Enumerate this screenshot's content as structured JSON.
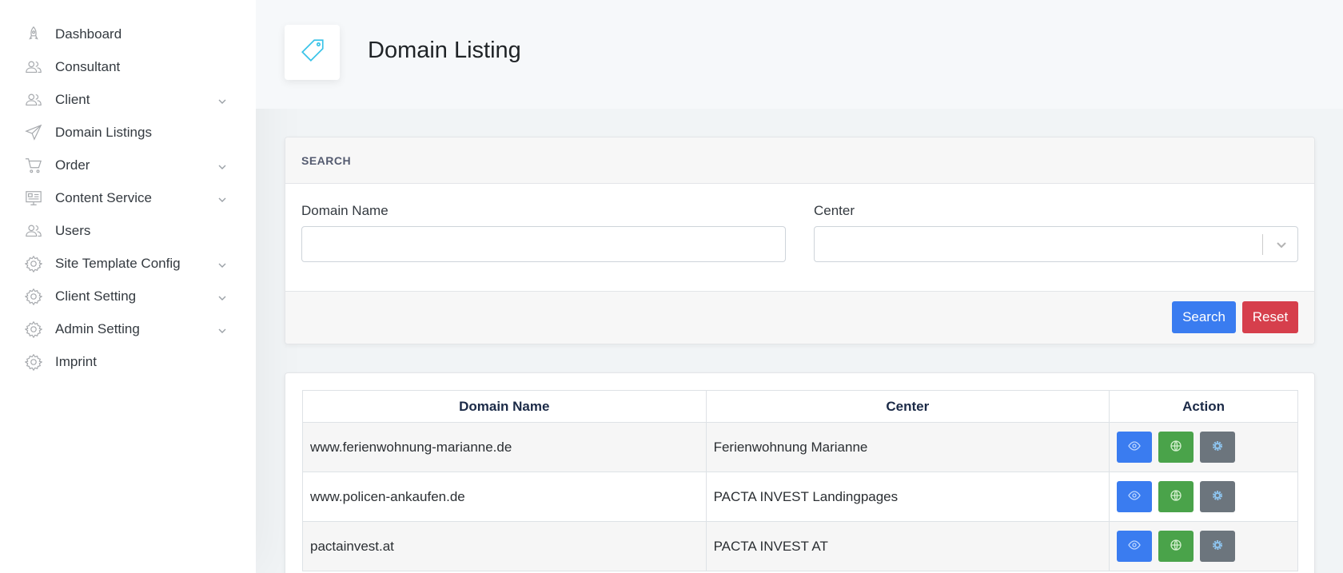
{
  "sidebar": {
    "items": [
      {
        "label": "Dashboard",
        "icon": "rocket-icon",
        "has_submenu": false
      },
      {
        "label": "Consultant",
        "icon": "users-icon",
        "has_submenu": false
      },
      {
        "label": "Client",
        "icon": "users-icon",
        "has_submenu": true
      },
      {
        "label": "Domain Listings",
        "icon": "paper-plane-icon",
        "has_submenu": false
      },
      {
        "label": "Order",
        "icon": "cart-icon",
        "has_submenu": true
      },
      {
        "label": "Content Service",
        "icon": "display-icon",
        "has_submenu": true
      },
      {
        "label": "Users",
        "icon": "users-icon",
        "has_submenu": false
      },
      {
        "label": "Site Template Config",
        "icon": "gear-icon",
        "has_submenu": true
      },
      {
        "label": "Client Setting",
        "icon": "gear-icon",
        "has_submenu": true
      },
      {
        "label": "Admin Setting",
        "icon": "gear-icon",
        "has_submenu": true
      },
      {
        "label": "Imprint",
        "icon": "gear-icon",
        "has_submenu": false
      }
    ]
  },
  "page": {
    "title": "Domain Listing",
    "title_icon": "tag-icon",
    "accent_color": "#3ac3e8"
  },
  "search": {
    "header": "SEARCH",
    "domain_label": "Domain Name",
    "domain_value": "",
    "center_label": "Center",
    "center_value": "",
    "search_button": "Search",
    "reset_button": "Reset",
    "search_color": "#3a7cf0",
    "reset_color": "#d63f4c"
  },
  "table": {
    "headers": [
      "Domain Name",
      "Center",
      "Action"
    ],
    "rows": [
      {
        "domain": "www.ferienwohnung-marianne.de",
        "center": "Ferienwohnung Marianne"
      },
      {
        "domain": "www.policen-ankaufen.de",
        "center": "PACTA INVEST Landingpages"
      },
      {
        "domain": "pactainvest.at",
        "center": "PACTA INVEST AT"
      }
    ],
    "action_icons": [
      "eye-icon",
      "globe-icon",
      "cog-icon"
    ]
  }
}
